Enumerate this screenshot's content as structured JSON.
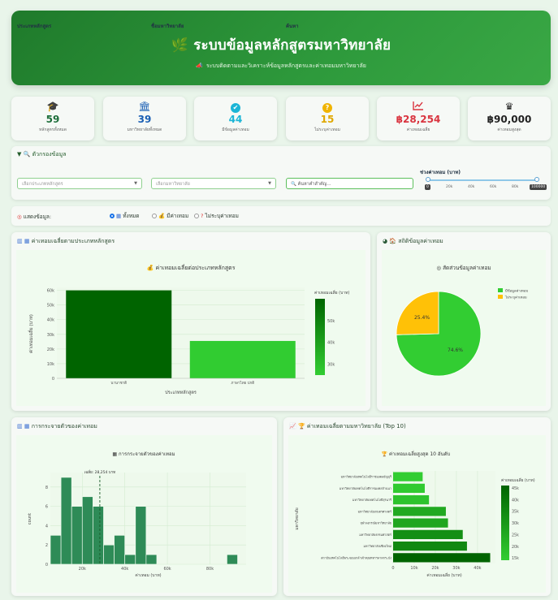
{
  "header": {
    "title": "ระบบข้อมูลหลักสูตรมหาวิทยาลัย",
    "subtitle": "ระบบติดตามและวิเคราะห์ข้อมูลหลักสูตรและค่าเทอมมหาวิทยาลัย"
  },
  "stats": [
    {
      "icon": "graduation-cap-icon",
      "glyph": "🎓",
      "value": "59",
      "label": "หลักสูตรทั้งหมด",
      "color": "#1d6e3a"
    },
    {
      "icon": "university-icon",
      "glyph": "🏛",
      "value": "39",
      "label": "มหาวิทยาลัยทั้งหมด",
      "color": "#1a5fb4"
    },
    {
      "icon": "check-circle-icon",
      "glyph": "✔",
      "value": "44",
      "label": "มีข้อมูลค่าเทอม",
      "color": "#1bb5d6"
    },
    {
      "icon": "question-icon",
      "glyph": "?",
      "value": "15",
      "label": "ไม่ระบุค่าเทอม",
      "color": "#e0a800"
    },
    {
      "icon": "chart-line-icon",
      "glyph": "📈",
      "value": "฿28,254",
      "label": "ค่าเทอมเฉลี่ย",
      "color": "#d9343f"
    },
    {
      "icon": "crown-icon",
      "glyph": "♛",
      "value": "฿90,000",
      "label": "ค่าเทอมสูงสุด",
      "color": "#222222"
    }
  ],
  "filter": {
    "title": "ตัวกรองข้อมูล",
    "type_label": "ประเภทหลักสูตร",
    "type_placeholder": "เลือกประเภทหลักสูตร",
    "uni_label": "ชื่อมหาวิทยาลัย",
    "uni_placeholder": "เลือกมหาวิทยาลัย",
    "search_label": "ค้นหา",
    "search_placeholder": "ค้นหาคำสำคัญ...",
    "range_label": "ช่วงค่าเทอม (บาท)",
    "range_ticks": [
      "0",
      "20k",
      "40k",
      "60k",
      "80k",
      "100000"
    ]
  },
  "display": {
    "label": "แสดงข้อมูล:",
    "options": [
      "ทั้งหมด",
      "มีค่าเทอม",
      "ไม่ระบุค่าเทอม"
    ]
  },
  "panels": {
    "p1_title": "ค่าเทอมเฉลี่ยตามประเภทหลักสูตร",
    "p2_title": "สถิติข้อมูลค่าเทอม",
    "p3_title": "การกระจายตัวของค่าเทอม",
    "p4_title": "ค่าเทอมเฉลี่ยตามมหาวิทยาลัย (Top 10)"
  },
  "chart_data": [
    {
      "type": "bar",
      "title": "ค่าเทอมเฉลี่ยต่อประเภทหลักสูตร",
      "categories": [
        "นานาชาติ",
        "ภาษาไทย ปกติ"
      ],
      "values": [
        60000,
        25500
      ],
      "xlabel": "ประเภทหลักสูตร",
      "ylabel": "ค่าเทอมเฉลี่ย (บาท)",
      "ylim": [
        0,
        62000
      ],
      "yticks": [
        "0",
        "10k",
        "20k",
        "30k",
        "40k",
        "50k",
        "60k"
      ],
      "colorbar_title": "ค่าเทอมเฉลี่ย (บาท)",
      "colorbar_ticks": [
        "30k",
        "40k",
        "50k"
      ]
    },
    {
      "type": "pie",
      "title": "สัดส่วนข้อมูลค่าเทอม",
      "labels": [
        "มีข้อมูลค่าเทอม",
        "ไม่ระบุค่าเทอม"
      ],
      "values": [
        74.6,
        25.4
      ],
      "value_labels": [
        "74.6%",
        "25.4%"
      ],
      "colors": [
        "#32cd32",
        "#ffc107"
      ]
    },
    {
      "type": "bar",
      "title": "การกระจายตัวของค่าเทอม",
      "bins_start": [
        5000,
        10000,
        15000,
        20000,
        25000,
        30000,
        35000,
        40000,
        45000,
        50000
      ],
      "values": [
        3,
        9,
        6,
        7,
        6,
        2,
        3,
        1,
        6,
        1
      ],
      "xlabel": "ค่าเทอม (บาท)",
      "ylabel": "count",
      "yticks": [
        "0",
        "2",
        "4",
        "6",
        "8"
      ],
      "xticks": [
        "20k",
        "40k",
        "60k",
        "80k"
      ],
      "mean_label": "เฉลี่ย: 28,254 บาท"
    },
    {
      "type": "bar",
      "title": "ค่าเทอมเฉลี่ยสูงสุด 10 อันดับ",
      "categories": [
        "สถาบันเทคโนโลยีพระจอมเกล้าเจ้าคุณทหารลาดกระบัง",
        "มหาวิทยาลัยเชียงใหม่",
        "มหาวิทยาลัยธรรมศาสตร์",
        "จุฬาลงกรณ์มหาวิทยาลัย",
        "มหาวิทยาลัยเกษตรศาสตร์",
        "มหาวิทยาลัยเทคโนโลยีสุรนารี",
        "มหาวิทยาลัยเทคโนโลยีราชมงคลล้านนา",
        "มหาวิทยาลัยเทคโนโลยีราชมงคลธัญบุรี"
      ],
      "values": [
        46000,
        35000,
        33000,
        26000,
        25000,
        17000,
        15000,
        14000
      ],
      "xlabel": "ค่าเทอมเฉลี่ย (บาท)",
      "ylabel": "มหาวิทยาลัย",
      "xticks": [
        "0",
        "10k",
        "20k",
        "30k",
        "40k"
      ],
      "colorbar_title": "ค่าเทอมเฉลี่ย (บาท)",
      "colorbar_ticks": [
        "15k",
        "20k",
        "25k",
        "30k",
        "35k",
        "40k",
        "45k"
      ]
    }
  ]
}
